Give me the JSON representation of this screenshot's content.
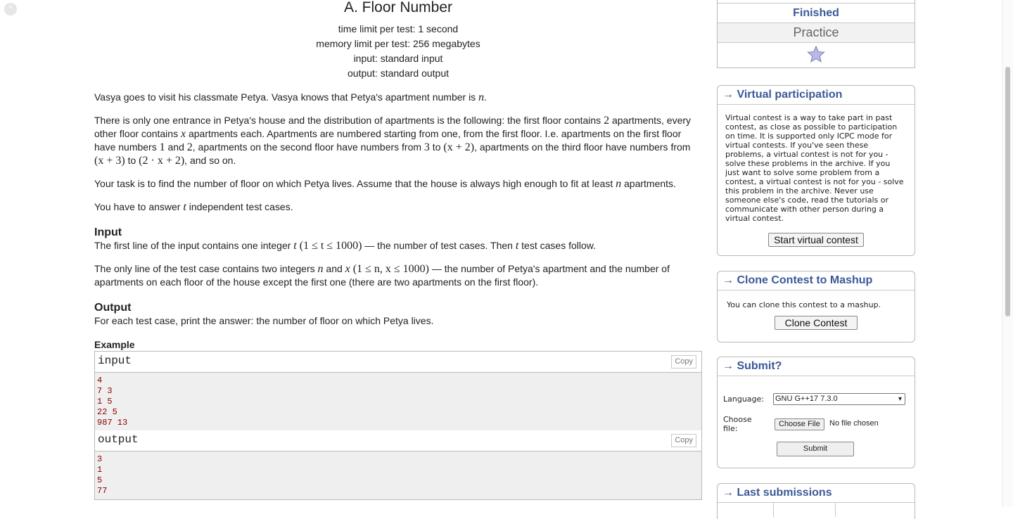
{
  "problem": {
    "title": "A. Floor Number",
    "time_limit": "time limit per test: 1 second",
    "memory_limit": "memory limit per test: 256 megabytes",
    "input_file": "input: standard input",
    "output_file": "output: standard output"
  },
  "statement": {
    "p1_a": "Vasya goes to visit his classmate Petya. Vasya knows that Petya's apartment number is ",
    "p1_n": "n",
    "p1_b": ".",
    "p2_a": "There is only one entrance in Petya's house and the distribution of apartments is the following: the first floor contains ",
    "p2_two": "2",
    "p2_b": " apartments, every other floor contains ",
    "p2_x": "x",
    "p2_c": " apartments each. Apartments are numbered starting from one, from the first floor. I.e. apartments on the first floor have numbers ",
    "p2_one": "1",
    "p2_d": " and ",
    "p2_two_b": "2",
    "p2_e": ", apartments on the second floor have numbers from ",
    "p2_three": "3",
    "p2_f": " to ",
    "p2_expr1": "(x + 2)",
    "p2_g": ", apartments on the third floor have numbers from ",
    "p2_expr2": "(x + 3)",
    "p2_h": " to ",
    "p2_expr3": "(2 · x + 2)",
    "p2_i": ", and so on.",
    "p3_a": "Your task is to find the number of floor on which Petya lives. Assume that the house is always high enough to fit at least ",
    "p3_n": "n",
    "p3_b": " apartments.",
    "p4_a": "You have to answer ",
    "p4_t": "t",
    "p4_b": " independent test cases."
  },
  "input_section": {
    "title": "Input",
    "l1_a": "The first line of the input contains one integer ",
    "l1_t": "t",
    "l1_expr": " (1 ≤ t ≤ 1000)",
    "l1_b": " — the number of test cases. Then ",
    "l1_t2": "t",
    "l1_c": " test cases follow.",
    "l2_a": "The only line of the test case contains two integers ",
    "l2_n": "n",
    "l2_b": " and ",
    "l2_x": "x",
    "l2_expr": " (1 ≤ n, x ≤ 1000)",
    "l2_c": " — the number of Petya's apartment and the number of apartments on each floor of the house except the first one (there are two apartments on the first floor)."
  },
  "output_section": {
    "title": "Output",
    "text": "For each test case, print the answer: the number of floor on which Petya lives."
  },
  "example": {
    "title": "Example",
    "input_label": "input",
    "output_label": "output",
    "copy_label": "Copy",
    "input_lines": [
      "4",
      "7 3",
      "1 5",
      "22 5",
      "987 13"
    ],
    "output_lines": [
      "3",
      "1",
      "5",
      "77"
    ]
  },
  "sidebar": {
    "status": "Finished",
    "mode": "Practice",
    "star_icon": "star-icon",
    "virtual": {
      "title": "→ Virtual participation",
      "text": "Virtual contest is a way to take part in past contest, as close as possible to participation on time. It is supported only ICPC mode for virtual contests. If you've seen these problems, a virtual contest is not for you - solve these problems in the archive. If you just want to solve some problem from a contest, a virtual contest is not for you - solve this problem in the archive. Never use someone else's code, read the tutorials or communicate with other person during a virtual contest.",
      "button": "Start virtual contest"
    },
    "clone": {
      "title": "→ Clone Contest to Mashup",
      "text": "You can clone this contest to a mashup.",
      "button": "Clone Contest"
    },
    "submit": {
      "title": "→ Submit?",
      "language_label": "Language:",
      "language_value": "GNU G++17 7.3.0",
      "file_label": "Choose file:",
      "file_button": "Choose File",
      "file_status": "No file chosen",
      "submit_button": "Submit"
    },
    "last": {
      "title": "→ Last submissions"
    }
  },
  "colors": {
    "link_blue": "#3b5998",
    "sample_red": "#8b0000",
    "border": "#b9b9b9"
  }
}
